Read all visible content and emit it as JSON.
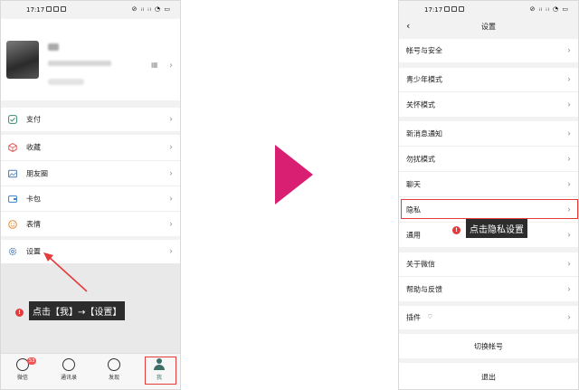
{
  "status": {
    "time": "17:17",
    "right_icons": "⊘ ᵢₗ ᵢₗ ◔ ▭"
  },
  "left": {
    "menu": [
      {
        "label": "支付",
        "icon": "pay-icon"
      },
      {
        "label": "收藏",
        "icon": "favorites-icon"
      },
      {
        "label": "朋友圈",
        "icon": "moments-icon"
      },
      {
        "label": "卡包",
        "icon": "cards-icon"
      },
      {
        "label": "表情",
        "icon": "emoji-icon"
      },
      {
        "label": "设置",
        "icon": "settings-icon"
      }
    ],
    "tabs": [
      {
        "label": "微信",
        "badge": "53"
      },
      {
        "label": "通讯录"
      },
      {
        "label": "发现"
      },
      {
        "label": "我"
      }
    ],
    "callout": "点击【我】→【设置】",
    "step_number": "!"
  },
  "right": {
    "title": "设置",
    "items": [
      {
        "label": "帐号与安全"
      },
      {
        "label": "青少年模式"
      },
      {
        "label": "关怀模式"
      },
      {
        "label": "新消息通知"
      },
      {
        "label": "勿扰模式"
      },
      {
        "label": "聊天"
      },
      {
        "label": "隐私"
      },
      {
        "label": "通用"
      },
      {
        "label": "关于微信"
      },
      {
        "label": "帮助与反馈"
      },
      {
        "label": "插件"
      }
    ],
    "switch_account": "切换帐号",
    "logout": "退出",
    "callout": "点击隐私设置",
    "step_number": "!"
  },
  "colors": {
    "accent_arrow": "#d81f72",
    "highlight": "#e23c3c",
    "wechat_green": "#3d6f66"
  }
}
